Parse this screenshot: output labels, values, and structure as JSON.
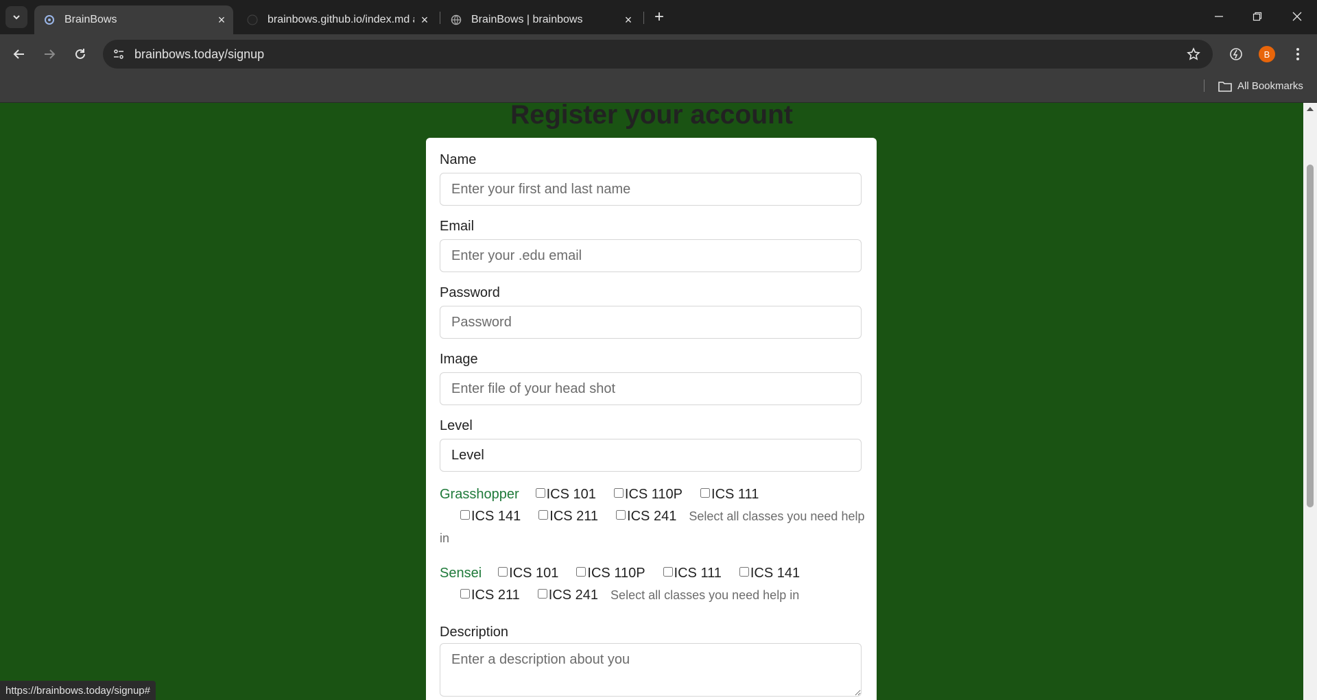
{
  "tabs": [
    {
      "title": "BrainBows",
      "favicon": "brainbows-icon",
      "active": true
    },
    {
      "title": "brainbows.github.io/index.md a",
      "favicon": "github-icon",
      "active": false
    },
    {
      "title": "BrainBows | brainbows",
      "favicon": "globe-icon",
      "active": false
    }
  ],
  "toolbar": {
    "url": "brainbows.today/signup",
    "profile_initial": "B"
  },
  "bookmarks": {
    "all_label": "All Bookmarks"
  },
  "page": {
    "heading": "Register your account",
    "name": {
      "label": "Name",
      "placeholder": "Enter your first and last name"
    },
    "email": {
      "label": "Email",
      "placeholder": "Enter your .edu email"
    },
    "password": {
      "label": "Password",
      "placeholder": "Password"
    },
    "image": {
      "label": "Image",
      "placeholder": "Enter file of your head shot"
    },
    "level": {
      "label": "Level",
      "value": "Level"
    },
    "grasshopper": {
      "label": "Grasshopper",
      "classes": [
        "ICS 101",
        "ICS 110P",
        "ICS 111",
        "ICS 141",
        "ICS 211",
        "ICS 241"
      ],
      "help": "Select all classes you need help in"
    },
    "sensei": {
      "label": "Sensei",
      "classes": [
        "ICS 101",
        "ICS 110P",
        "ICS 111",
        "ICS 141",
        "ICS 211",
        "ICS 241"
      ],
      "help": "Select all classes you need help in"
    },
    "description": {
      "label": "Description",
      "placeholder": "Enter a description about you"
    }
  },
  "status_url": "https://brainbows.today/signup#",
  "colors": {
    "page_bg": "#1a5313",
    "group_label": "#1f7a3a"
  }
}
